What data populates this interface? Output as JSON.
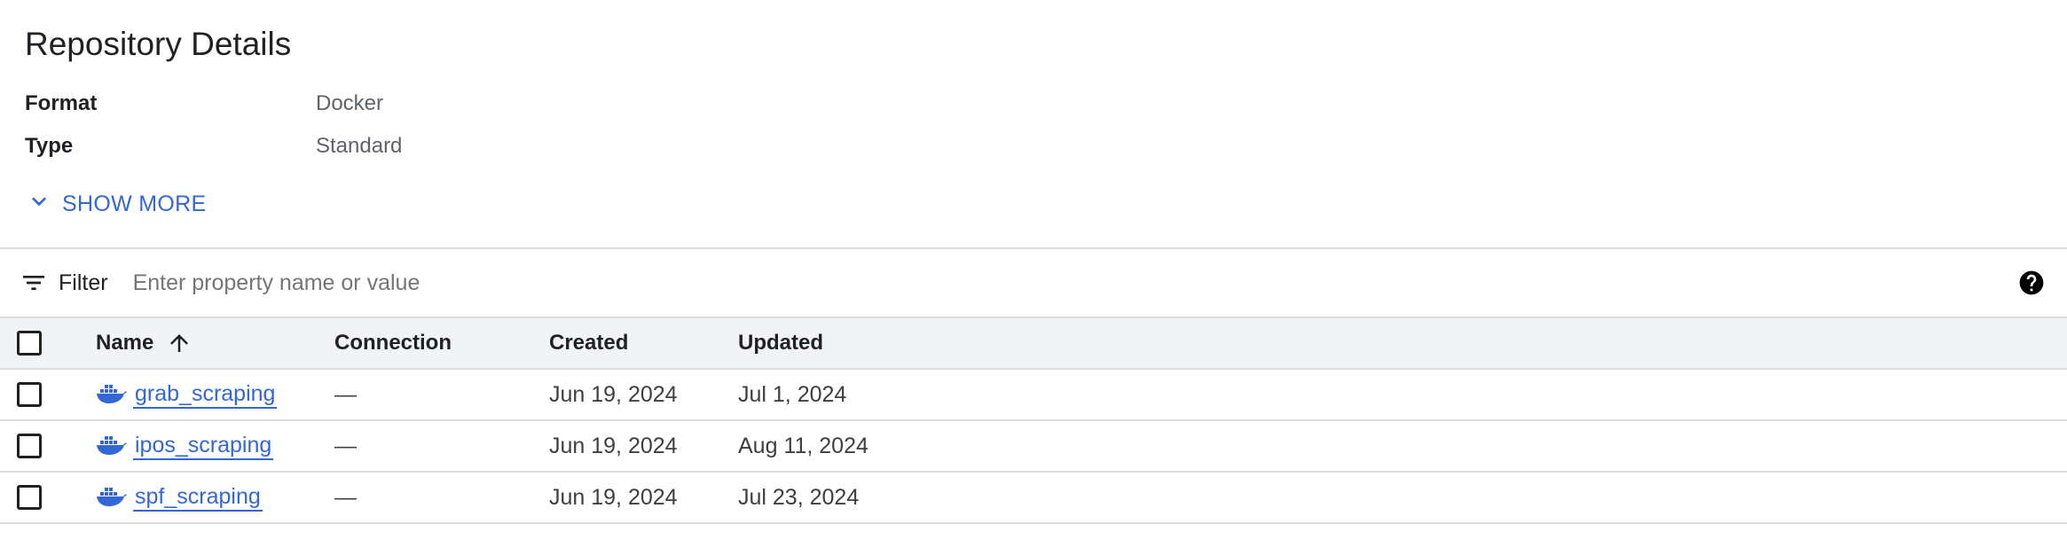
{
  "page": {
    "title": "Repository Details"
  },
  "details": {
    "properties": [
      {
        "key": "Format",
        "value": "Docker"
      },
      {
        "key": "Type",
        "value": "Standard"
      }
    ],
    "show_more_label": "SHOW MORE"
  },
  "filter": {
    "label": "Filter",
    "placeholder": "Enter property name or value",
    "value": ""
  },
  "table": {
    "columns": {
      "name": "Name",
      "connection": "Connection",
      "created": "Created",
      "updated": "Updated"
    },
    "sort": {
      "column": "Name",
      "direction": "ascending"
    },
    "rows": [
      {
        "name": "grab_scraping",
        "connection": "—",
        "created": "Jun 19, 2024",
        "updated": "Jul 1, 2024",
        "icon": "docker-icon"
      },
      {
        "name": "ipos_scraping",
        "connection": "—",
        "created": "Jun 19, 2024",
        "updated": "Aug 11, 2024",
        "icon": "docker-icon"
      },
      {
        "name": "spf_scraping",
        "connection": "—",
        "created": "Jun 19, 2024",
        "updated": "Jul 23, 2024",
        "icon": "docker-icon"
      }
    ]
  },
  "colors": {
    "link": "#3367d6",
    "text": "#202124",
    "muted": "#5f6368",
    "divider": "#dadce0",
    "header_bg": "#f1f3f4"
  }
}
